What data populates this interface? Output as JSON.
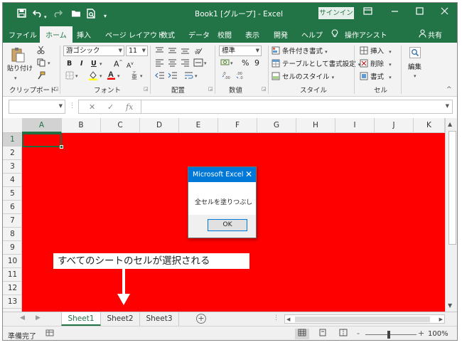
{
  "window": {
    "title": "Book1 [グループ] - Excel",
    "signin_label": "サインイン"
  },
  "quick_access": {
    "save_icon": "save-icon",
    "undo_icon": "undo-icon",
    "redo_icon": "redo-icon",
    "open_icon": "folder-icon",
    "preview_icon": "print-preview-icon"
  },
  "tabs": [
    {
      "label": "ファイル"
    },
    {
      "label": "ホーム"
    },
    {
      "label": "挿入"
    },
    {
      "label": "ページ レイアウト"
    },
    {
      "label": "数式"
    },
    {
      "label": "データ"
    },
    {
      "label": "校閲"
    },
    {
      "label": "表示"
    },
    {
      "label": "開発"
    },
    {
      "label": "ヘルプ"
    },
    {
      "label": "操作アシスト"
    },
    {
      "label": "共有"
    }
  ],
  "ribbon": {
    "clipboard": {
      "paste_label": "貼り付け",
      "group_label": "クリップボード"
    },
    "font": {
      "font_name": "游ゴシック",
      "font_size": "11",
      "bold": "B",
      "italic": "I",
      "underline": "U",
      "group_label": "フォント"
    },
    "alignment": {
      "group_label": "配置"
    },
    "number": {
      "format": "標準",
      "percent": "%",
      "comma": "9",
      "group_label": "数値"
    },
    "styles": {
      "conditional_label": "条件付き書式",
      "table_label": "テーブルとして書式設定",
      "cell_style_label": "セルのスタイル",
      "group_label": "スタイル"
    },
    "cells": {
      "insert_label": "挿入",
      "delete_label": "削除",
      "format_label": "書式",
      "group_label": "セル"
    },
    "editing": {
      "label": "編集"
    }
  },
  "formula_bar": {
    "name_box": "",
    "fx": "fx",
    "content": ""
  },
  "grid": {
    "columns": [
      "A",
      "B",
      "C",
      "D",
      "E",
      "F",
      "G",
      "H",
      "I",
      "J",
      "K"
    ],
    "rows": [
      "1",
      "2",
      "3",
      "4",
      "5",
      "6",
      "7",
      "8",
      "9",
      "10",
      "11",
      "12",
      "13"
    ],
    "fill_color": "#ff0000",
    "active_cell": "A1"
  },
  "callout": {
    "text": "すべてのシートのセルが選択される"
  },
  "dialog": {
    "title": "Microsoft Excel",
    "message": "全セルを塗りつぶし",
    "ok_label": "OK"
  },
  "sheets": [
    {
      "label": "Sheet1",
      "active": true
    },
    {
      "label": "Sheet2",
      "active": false
    },
    {
      "label": "Sheet3",
      "active": false
    }
  ],
  "status": {
    "ready": "準備完了",
    "zoom": "100%",
    "zoom_minus": "-",
    "zoom_plus": "+"
  },
  "colors": {
    "excel_green": "#227447",
    "dialog_blue": "#0078d7"
  }
}
